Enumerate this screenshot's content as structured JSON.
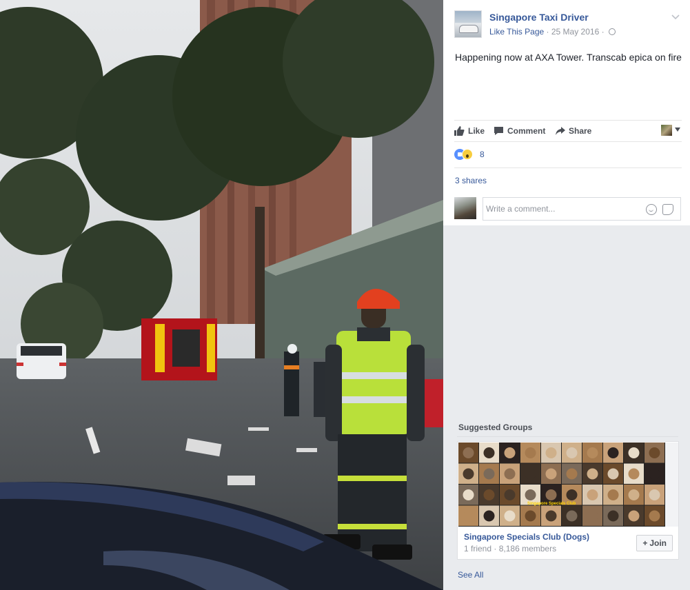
{
  "post": {
    "page_name": "Singapore Taxi Driver",
    "like_page": "Like This Page",
    "separator": "·",
    "date": "25 May 2016",
    "text": "Happening now at AXA Tower. Transcab epica on fire",
    "actions": {
      "like": "Like",
      "comment": "Comment",
      "share": "Share"
    },
    "reaction_count": "8",
    "shares": "3 shares",
    "comment_placeholder": "Write a comment..."
  },
  "suggested_groups": {
    "title": "Suggested Groups",
    "group": {
      "name": "Singapore Specials Club (Dogs)",
      "friends": "1 friend",
      "members": "8,186 members",
      "join_label": "Join",
      "cover_text": "Singapore Specials Club"
    },
    "see_all": "See All"
  },
  "colors": {
    "link_blue": "#365899",
    "reaction_like": "#5890ff",
    "reaction_wow": "#f7cd3e",
    "background": "#e9ebee"
  },
  "icons": [
    "thumbs-up-icon",
    "comment-icon",
    "share-icon",
    "globe-icon",
    "chevron-down-icon",
    "smiley-icon",
    "sticker-icon"
  ]
}
